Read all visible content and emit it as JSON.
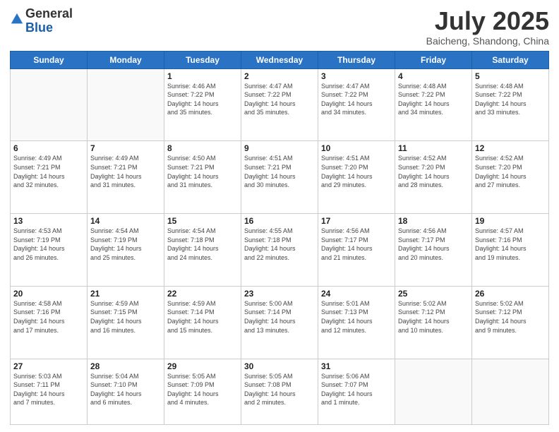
{
  "header": {
    "logo_general": "General",
    "logo_blue": "Blue",
    "month": "July 2025",
    "location": "Baicheng, Shandong, China"
  },
  "days_of_week": [
    "Sunday",
    "Monday",
    "Tuesday",
    "Wednesday",
    "Thursday",
    "Friday",
    "Saturday"
  ],
  "weeks": [
    [
      {
        "day": "",
        "info": ""
      },
      {
        "day": "",
        "info": ""
      },
      {
        "day": "1",
        "info": "Sunrise: 4:46 AM\nSunset: 7:22 PM\nDaylight: 14 hours\nand 35 minutes."
      },
      {
        "day": "2",
        "info": "Sunrise: 4:47 AM\nSunset: 7:22 PM\nDaylight: 14 hours\nand 35 minutes."
      },
      {
        "day": "3",
        "info": "Sunrise: 4:47 AM\nSunset: 7:22 PM\nDaylight: 14 hours\nand 34 minutes."
      },
      {
        "day": "4",
        "info": "Sunrise: 4:48 AM\nSunset: 7:22 PM\nDaylight: 14 hours\nand 34 minutes."
      },
      {
        "day": "5",
        "info": "Sunrise: 4:48 AM\nSunset: 7:22 PM\nDaylight: 14 hours\nand 33 minutes."
      }
    ],
    [
      {
        "day": "6",
        "info": "Sunrise: 4:49 AM\nSunset: 7:21 PM\nDaylight: 14 hours\nand 32 minutes."
      },
      {
        "day": "7",
        "info": "Sunrise: 4:49 AM\nSunset: 7:21 PM\nDaylight: 14 hours\nand 31 minutes."
      },
      {
        "day": "8",
        "info": "Sunrise: 4:50 AM\nSunset: 7:21 PM\nDaylight: 14 hours\nand 31 minutes."
      },
      {
        "day": "9",
        "info": "Sunrise: 4:51 AM\nSunset: 7:21 PM\nDaylight: 14 hours\nand 30 minutes."
      },
      {
        "day": "10",
        "info": "Sunrise: 4:51 AM\nSunset: 7:20 PM\nDaylight: 14 hours\nand 29 minutes."
      },
      {
        "day": "11",
        "info": "Sunrise: 4:52 AM\nSunset: 7:20 PM\nDaylight: 14 hours\nand 28 minutes."
      },
      {
        "day": "12",
        "info": "Sunrise: 4:52 AM\nSunset: 7:20 PM\nDaylight: 14 hours\nand 27 minutes."
      }
    ],
    [
      {
        "day": "13",
        "info": "Sunrise: 4:53 AM\nSunset: 7:19 PM\nDaylight: 14 hours\nand 26 minutes."
      },
      {
        "day": "14",
        "info": "Sunrise: 4:54 AM\nSunset: 7:19 PM\nDaylight: 14 hours\nand 25 minutes."
      },
      {
        "day": "15",
        "info": "Sunrise: 4:54 AM\nSunset: 7:18 PM\nDaylight: 14 hours\nand 24 minutes."
      },
      {
        "day": "16",
        "info": "Sunrise: 4:55 AM\nSunset: 7:18 PM\nDaylight: 14 hours\nand 22 minutes."
      },
      {
        "day": "17",
        "info": "Sunrise: 4:56 AM\nSunset: 7:17 PM\nDaylight: 14 hours\nand 21 minutes."
      },
      {
        "day": "18",
        "info": "Sunrise: 4:56 AM\nSunset: 7:17 PM\nDaylight: 14 hours\nand 20 minutes."
      },
      {
        "day": "19",
        "info": "Sunrise: 4:57 AM\nSunset: 7:16 PM\nDaylight: 14 hours\nand 19 minutes."
      }
    ],
    [
      {
        "day": "20",
        "info": "Sunrise: 4:58 AM\nSunset: 7:16 PM\nDaylight: 14 hours\nand 17 minutes."
      },
      {
        "day": "21",
        "info": "Sunrise: 4:59 AM\nSunset: 7:15 PM\nDaylight: 14 hours\nand 16 minutes."
      },
      {
        "day": "22",
        "info": "Sunrise: 4:59 AM\nSunset: 7:14 PM\nDaylight: 14 hours\nand 15 minutes."
      },
      {
        "day": "23",
        "info": "Sunrise: 5:00 AM\nSunset: 7:14 PM\nDaylight: 14 hours\nand 13 minutes."
      },
      {
        "day": "24",
        "info": "Sunrise: 5:01 AM\nSunset: 7:13 PM\nDaylight: 14 hours\nand 12 minutes."
      },
      {
        "day": "25",
        "info": "Sunrise: 5:02 AM\nSunset: 7:12 PM\nDaylight: 14 hours\nand 10 minutes."
      },
      {
        "day": "26",
        "info": "Sunrise: 5:02 AM\nSunset: 7:12 PM\nDaylight: 14 hours\nand 9 minutes."
      }
    ],
    [
      {
        "day": "27",
        "info": "Sunrise: 5:03 AM\nSunset: 7:11 PM\nDaylight: 14 hours\nand 7 minutes."
      },
      {
        "day": "28",
        "info": "Sunrise: 5:04 AM\nSunset: 7:10 PM\nDaylight: 14 hours\nand 6 minutes."
      },
      {
        "day": "29",
        "info": "Sunrise: 5:05 AM\nSunset: 7:09 PM\nDaylight: 14 hours\nand 4 minutes."
      },
      {
        "day": "30",
        "info": "Sunrise: 5:05 AM\nSunset: 7:08 PM\nDaylight: 14 hours\nand 2 minutes."
      },
      {
        "day": "31",
        "info": "Sunrise: 5:06 AM\nSunset: 7:07 PM\nDaylight: 14 hours\nand 1 minute."
      },
      {
        "day": "",
        "info": ""
      },
      {
        "day": "",
        "info": ""
      }
    ]
  ]
}
